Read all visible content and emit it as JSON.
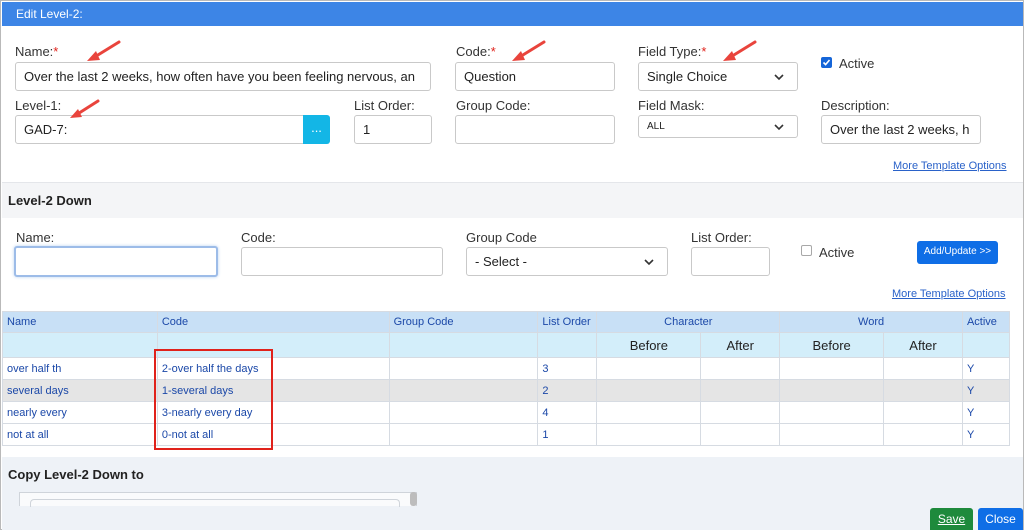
{
  "window": {
    "title": "Edit Level-2:"
  },
  "top_form": {
    "name": {
      "label": "Name:",
      "value": "Over the last 2 weeks, how often have you been feeling nervous, an"
    },
    "code": {
      "label": "Code:",
      "value": "Question"
    },
    "field_type": {
      "label": "Field Type:",
      "value": "Single Choice"
    },
    "active": {
      "label": "Active",
      "checked": true
    },
    "level1": {
      "label": "Level-1:",
      "value": "GAD-7:",
      "browse_label": "..."
    },
    "list_order": {
      "label": "List Order:",
      "value": "1"
    },
    "group_code": {
      "label": "Group Code:",
      "value": ""
    },
    "field_mask": {
      "label": "Field Mask:",
      "value": "ALL"
    },
    "description": {
      "label": "Description:",
      "value": "Over the last 2 weeks, h"
    },
    "required_mark": "*",
    "more_options": "More Template Options"
  },
  "level2_down": {
    "title": "Level-2 Down",
    "name": {
      "label": "Name:",
      "value": ""
    },
    "code": {
      "label": "Code:",
      "value": ""
    },
    "group_code": {
      "label": "Group Code",
      "value": "- Select -"
    },
    "list_order": {
      "label": "List Order:",
      "value": ""
    },
    "active": {
      "label": "Active",
      "checked": false
    },
    "add_update": "Add/Update >>",
    "more_options": "More Template Options"
  },
  "grid": {
    "headers": {
      "name": "Name",
      "code": "Code",
      "group_code": "Group Code",
      "list_order": "List Order",
      "character": "Character",
      "word": "Word",
      "active": "Active",
      "before": "Before",
      "after": "After"
    },
    "rows": [
      {
        "name": "over half th",
        "code": "2-over half the days",
        "group_code": "",
        "list_order": "3",
        "active": "Y"
      },
      {
        "name": "several days",
        "code": "1-several days",
        "group_code": "",
        "list_order": "2",
        "active": "Y"
      },
      {
        "name": "nearly every",
        "code": "3-nearly every day",
        "group_code": "",
        "list_order": "4",
        "active": "Y"
      },
      {
        "name": "not at all",
        "code": "0-not at all",
        "group_code": "",
        "list_order": "1",
        "active": "Y"
      }
    ]
  },
  "copy_section": {
    "title": "Copy Level-2 Down to"
  },
  "footer": {
    "save": "Save",
    "close": "Close"
  },
  "colors": {
    "titlebar": "#3d85e6",
    "annotation_red": "#e0221b",
    "save_green": "#1e8a3c",
    "close_blue": "#0f6ee6"
  }
}
